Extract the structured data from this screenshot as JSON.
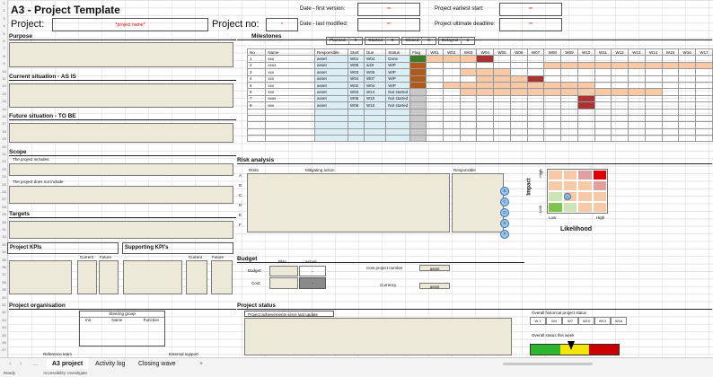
{
  "header": {
    "title": "A3 - Project Template",
    "project_label": "Project:",
    "project_name": "*project name*",
    "project_no_label": "Project no:",
    "project_no_value": "*",
    "first_version_label": "Date - first version:",
    "last_modified_label": "Date - last modified:",
    "date_placeholder": "**",
    "earliest_start_label": "Project earliest start:",
    "deadline_label": "Project ultimate deadline:"
  },
  "sections": {
    "purpose": "Purpose",
    "current": "Current situation - AS IS",
    "future": "Future situation - TO BE",
    "scope": "Scope",
    "scope_includes": "The project includes:",
    "scope_excludes": "The project does not include",
    "targets": "Targets",
    "kpis": "Project KPIs",
    "supporting_kpis": "Supporting KPI's",
    "current_col": "Current",
    "future_col": "Future",
    "organisation": "Project organisation",
    "steering": "Steering group",
    "init": "Init",
    "name": "Name",
    "function": "Function",
    "reference": "Reference team",
    "external": "External support"
  },
  "milestones": {
    "title": "Milestones",
    "summary": [
      {
        "label": "Planned",
        "value": "0"
      },
      {
        "label": "Started",
        "value": "0"
      },
      {
        "label": "Closed",
        "value": "0"
      },
      {
        "label": "Delayed",
        "value": "1"
      }
    ],
    "columns": [
      "No",
      "Name",
      "Responsible",
      "Start",
      "Due",
      "Status",
      "Flag"
    ],
    "weeks": [
      "W01",
      "W02",
      "W03",
      "W04",
      "W05",
      "W06",
      "W07",
      "W08",
      "W09",
      "W10",
      "W11",
      "W12",
      "W13",
      "W14",
      "W15",
      "W16",
      "W17"
    ],
    "rows": [
      {
        "no": "1",
        "name": "xxx",
        "resp": "asset",
        "start": "W01",
        "due": "W04",
        "status": "Done",
        "flag": "#3a7d2c",
        "bar": [
          0,
          3
        ],
        "dark": [
          3
        ]
      },
      {
        "no": "2",
        "name": "xxxx",
        "resp": "asset",
        "start": "W08",
        "due": "w20",
        "status": "WIP",
        "flag": "#b05a1a",
        "bar": [
          7,
          16
        ],
        "dark": []
      },
      {
        "no": "3",
        "name": "xxx",
        "resp": "asset",
        "start": "W03",
        "due": "W05",
        "status": "WIP",
        "flag": "#b05a1a",
        "bar": [
          2,
          4
        ],
        "dark": []
      },
      {
        "no": "4",
        "name": "xxx",
        "resp": "asset",
        "start": "W04",
        "due": "W07",
        "status": "WIP",
        "flag": "#b05a1a",
        "bar": [
          3,
          6
        ],
        "dark": [
          6
        ]
      },
      {
        "no": "5",
        "name": "xxx",
        "resp": "asset",
        "start": "W02",
        "due": "W04",
        "status": "WIP",
        "flag": "#b05a1a",
        "bar": [
          1,
          9
        ],
        "dark": []
      },
      {
        "no": "6",
        "name": "xxx",
        "resp": "asset",
        "start": "W03",
        "due": "W14",
        "status": "Not started",
        "flag": "#c8c8c8",
        "bar": [
          2,
          13
        ],
        "dark": []
      },
      {
        "no": "7",
        "name": "xxxx",
        "resp": "asset",
        "start": "W08",
        "due": "W10",
        "status": "Not started",
        "flag": "#c8c8c8",
        "bar": [],
        "dark": [
          9
        ]
      },
      {
        "no": "8",
        "name": "xxx",
        "resp": "asset",
        "start": "W06",
        "due": "W10",
        "status": "Not started",
        "flag": "#c8c8c8",
        "bar": [],
        "dark": [
          9
        ]
      }
    ]
  },
  "risk": {
    "title": "Risk analysis",
    "cols": [
      "Risks",
      "Mitigating action",
      "Responsible"
    ],
    "letters": [
      "A",
      "B",
      "C",
      "D",
      "E",
      "F"
    ],
    "impact": "Impact",
    "likelihood": "Likelihood",
    "high": "High",
    "low": "Low",
    "marker": "A",
    "matrix": [
      [
        "#f8c9a6",
        "#f8c9a6",
        "#e0a0a0",
        "#e00000"
      ],
      [
        "#f8c9a6",
        "#f8c9a6",
        "#f8c9a6",
        "#e0a0a0"
      ],
      [
        "#cde5b4",
        "#f8c9a6",
        "#f8c9a6",
        "#f8c9a6"
      ],
      [
        "#7fc24f",
        "#cde5b4",
        "#f8c9a6",
        "#f8c9a6"
      ]
    ]
  },
  "budget": {
    "title": "Budget",
    "plan": "Plan",
    "actual": "Actual",
    "budget": "Budget:",
    "cost": "Cost:",
    "dash": "-",
    "cost_project_number": "Cost project number",
    "currency": "Currency",
    "asset": "asset"
  },
  "status": {
    "title": "Project status",
    "achievements": "Project achievements since last update",
    "historical": "Overall historical project status",
    "weeks": [
      "W 1",
      "W4",
      "W7",
      "W10",
      "W13",
      "W16"
    ],
    "this_week": "Overall status this week",
    "colors": [
      "#2db52d",
      "#f5e60a",
      "#cc0000"
    ]
  },
  "tabs": {
    "items": [
      "A3 project",
      "Activity log",
      "Closing wave"
    ],
    "add": "+",
    "active": 0
  },
  "statusbar": {
    "ready": "Ready",
    "accessibility": "Accessibility: Investigate"
  }
}
